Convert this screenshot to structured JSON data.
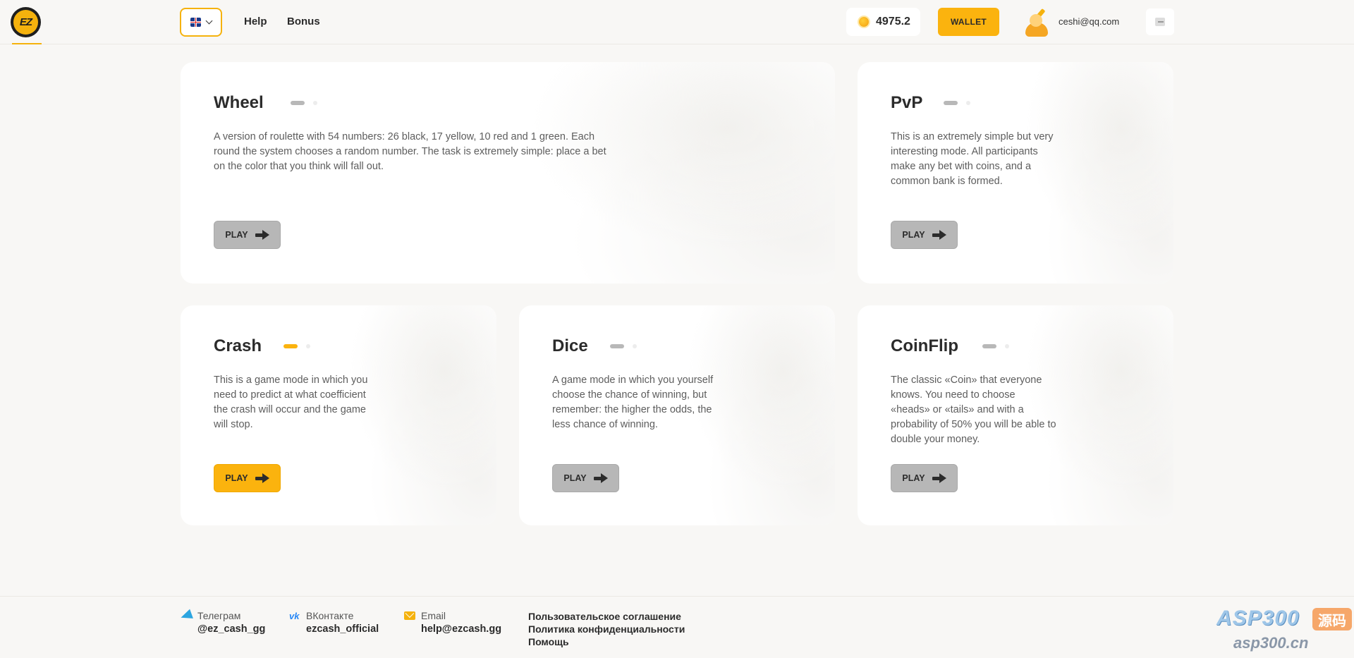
{
  "header": {
    "nav": [
      {
        "label": "Help"
      },
      {
        "label": "Bonus"
      }
    ],
    "balance": "4975.2",
    "wallet_label": "WALLET",
    "user_email": "ceshi@qq.com"
  },
  "games": [
    {
      "title": "Wheel",
      "description": "A version of roulette with 54 numbers: 26 black, 17 yellow, 10 red and 1 green. Each round the system chooses a random number. The task is extremely simple: place a bet on the color that you think will fall out.",
      "play_label": "PLAY",
      "active": false
    },
    {
      "title": "PvP",
      "description": "This is an extremely simple but very interesting mode. All participants make any bet with coins, and a common bank is formed.",
      "play_label": "PLAY",
      "active": false
    },
    {
      "title": "Crash",
      "description": "This is a game mode in which you need to predict at what coefficient the crash will occur and the game will stop.",
      "play_label": "PLAY",
      "active": true
    },
    {
      "title": "Dice",
      "description": "A game mode in which you yourself choose the chance of winning, but remember: the higher the odds, the less chance of winning.",
      "play_label": "PLAY",
      "active": false
    },
    {
      "title": "CoinFlip",
      "description": "The classic «Coin» that everyone knows. You need to choose «heads» or «tails» and with a probability of 50% you will be able to double your money.",
      "play_label": "PLAY",
      "active": false
    }
  ],
  "footer": {
    "contacts": [
      {
        "label": "Телеграм",
        "value": "@ez_cash_gg",
        "icon": "telegram-icon"
      },
      {
        "label": "ВКонтакте",
        "value": "ezcash_official",
        "icon": "vk-icon"
      },
      {
        "label": "Email",
        "value": "help@ezcash.gg",
        "icon": "mail-icon"
      }
    ],
    "links": [
      "Пользовательское соглашение",
      "Политика конфиденциальности",
      "Помощь"
    ]
  },
  "watermark": {
    "top": "ASP300",
    "badge": "源码",
    "bottom": "asp300.cn"
  },
  "colors": {
    "accent": "#fbb30e",
    "inactive_button": "#b7b7b7",
    "background": "#f8f7f5"
  }
}
